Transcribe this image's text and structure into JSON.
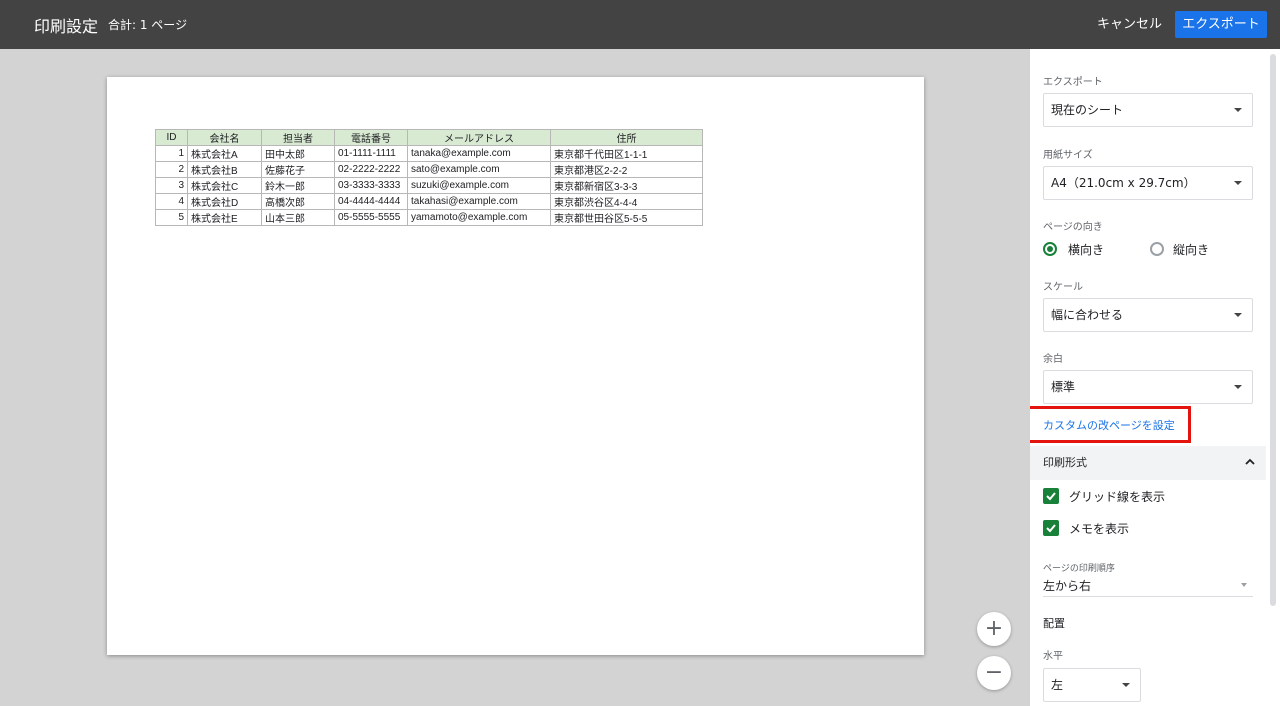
{
  "header": {
    "title": "印刷設定",
    "subtitle": "合計: 1 ページ",
    "cancel_label": "キャンセル",
    "export_label": "エクスポート"
  },
  "preview": {
    "table": {
      "headers": [
        "ID",
        "会社名",
        "担当者",
        "電話番号",
        "メールアドレス",
        "住所"
      ],
      "rows": [
        [
          "1",
          "株式会社A",
          "田中太郎",
          "01-1111-1111",
          "tanaka@example.com",
          "東京都千代田区1-1-1"
        ],
        [
          "2",
          "株式会社B",
          "佐藤花子",
          "02-2222-2222",
          "sato@example.com",
          "東京都港区2-2-2"
        ],
        [
          "3",
          "株式会社C",
          "鈴木一郎",
          "03-3333-3333",
          "suzuki@example.com",
          "東京都新宿区3-3-3"
        ],
        [
          "4",
          "株式会社D",
          "高橋次郎",
          "04-4444-4444",
          "takahasi@example.com",
          "東京都渋谷区4-4-4"
        ],
        [
          "5",
          "株式会社E",
          "山本三郎",
          "05-5555-5555",
          "yamamoto@example.com",
          "東京都世田谷区5-5-5"
        ]
      ]
    },
    "zoom_in_icon": "+",
    "zoom_out_icon": "−"
  },
  "sidebar": {
    "export_label": "エクスポート",
    "export_value": "現在のシート",
    "paper_label": "用紙サイズ",
    "paper_value": "A4（21.0cm x 29.7cm）",
    "orientation_label": "ページの向き",
    "orientation_landscape": "横向き",
    "orientation_portrait": "縦向き",
    "scale_label": "スケール",
    "scale_value": "幅に合わせる",
    "margin_label": "余白",
    "margin_value": "標準",
    "custom_break_link": "カスタムの改ページを設定",
    "format_section": "印刷形式",
    "gridlines_label": "グリッド線を表示",
    "notes_label": "メモを表示",
    "order_label": "ページの印刷順序",
    "order_value": "左から右",
    "layout_title": "配置",
    "horizontal_label": "水平",
    "horizontal_value": "左"
  },
  "colors": {
    "header_bg": "#434343",
    "accent": "#1a73e8",
    "check_green": "#188038",
    "highlight_red": "#e3140d",
    "table_header_bg": "#d9ead3"
  }
}
